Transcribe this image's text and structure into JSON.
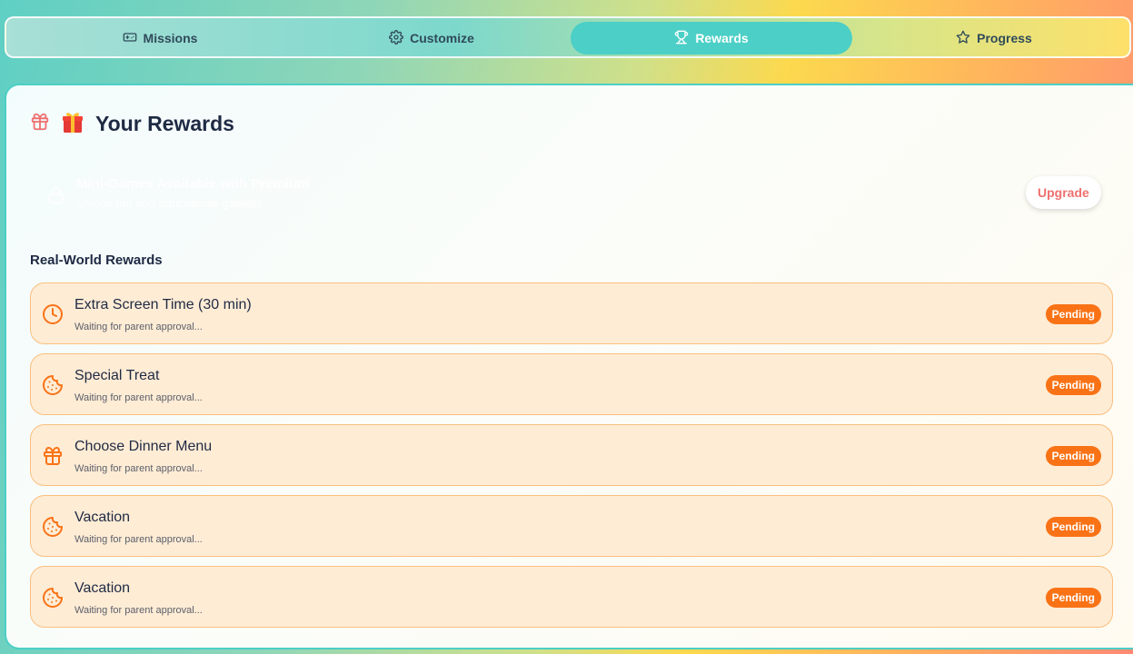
{
  "tabs": [
    {
      "label": "Missions",
      "icon": "gamepad-icon",
      "active": false
    },
    {
      "label": "Customize",
      "icon": "gear-icon",
      "active": false
    },
    {
      "label": "Rewards",
      "icon": "trophy-icon",
      "active": true
    },
    {
      "label": "Progress",
      "icon": "star-icon",
      "active": false
    }
  ],
  "header": {
    "title": "Your Rewards"
  },
  "premium_banner": {
    "title": "Mini-Games Available with Premium",
    "subtitle": "Unlock fun and educational games!",
    "button_label": "Upgrade"
  },
  "rewards_section": {
    "title": "Real-World Rewards",
    "items": [
      {
        "name": "Extra Screen Time (30 min)",
        "status_text": "Waiting for parent approval...",
        "badge": "Pending",
        "icon": "clock-icon"
      },
      {
        "name": "Special Treat",
        "status_text": "Waiting for parent approval...",
        "badge": "Pending",
        "icon": "cookie-icon"
      },
      {
        "name": "Choose Dinner Menu",
        "status_text": "Waiting for parent approval...",
        "badge": "Pending",
        "icon": "gift-icon"
      },
      {
        "name": "Vacation",
        "status_text": "Waiting for parent approval...",
        "badge": "Pending",
        "icon": "cookie-icon"
      },
      {
        "name": "Vacation",
        "status_text": "Waiting for parent approval...",
        "badge": "Pending",
        "icon": "cookie-icon"
      }
    ]
  },
  "colors": {
    "accent": "#4ccfc6",
    "pending_badge": "#f97316",
    "reward_bg": "#ffecd5",
    "upgrade_text": "#ef6f6f"
  }
}
